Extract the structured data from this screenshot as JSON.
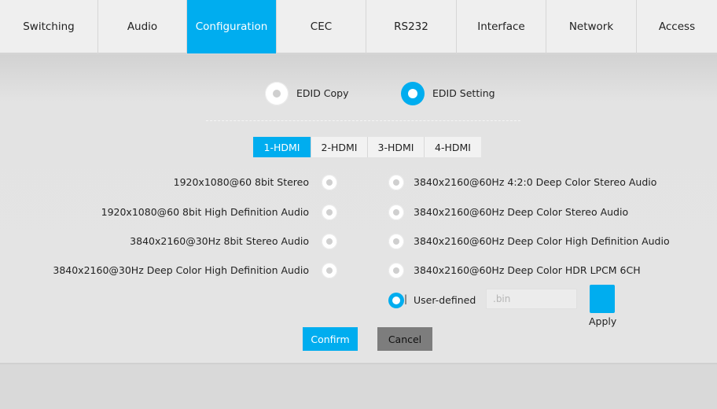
{
  "nav": {
    "tabs": [
      {
        "label": "Switching"
      },
      {
        "label": "Audio"
      },
      {
        "label": "Configuration"
      },
      {
        "label": "CEC"
      },
      {
        "label": "RS232"
      },
      {
        "label": "Interface"
      },
      {
        "label": "Network"
      },
      {
        "label": "Access"
      }
    ],
    "active_index": 2
  },
  "mode": {
    "edid_copy_label": "EDID Copy",
    "edid_setting_label": "EDID Setting",
    "selected": "EDID Setting"
  },
  "hdmi_tabs": [
    "1-HDMI",
    "2-HDMI",
    "3-HDMI",
    "4-HDMI"
  ],
  "hdmi_active": "1-HDMI",
  "edid_left": [
    "1920x1080@60 8bit Stereo",
    "1920x1080@60 8bit High Definition Audio",
    "3840x2160@30Hz 8bit Stereo Audio",
    "3840x2160@30Hz Deep Color High Definition Audio"
  ],
  "edid_right": [
    "3840x2160@60Hz 4:2:0 Deep Color Stereo Audio",
    "3840x2160@60Hz Deep Color Stereo Audio",
    "3840x2160@60Hz Deep Color High Definition Audio",
    "3840x2160@60Hz Deep Color HDR LPCM 6CH"
  ],
  "user_defined": {
    "label": "User-defined",
    "file_placeholder": ".bin",
    "apply_label": "Apply",
    "selected": true
  },
  "actions": {
    "confirm_label": "Confirm",
    "cancel_label": "Cancel"
  },
  "colors": {
    "accent": "#00adef",
    "cancel": "#7d7d7d"
  }
}
